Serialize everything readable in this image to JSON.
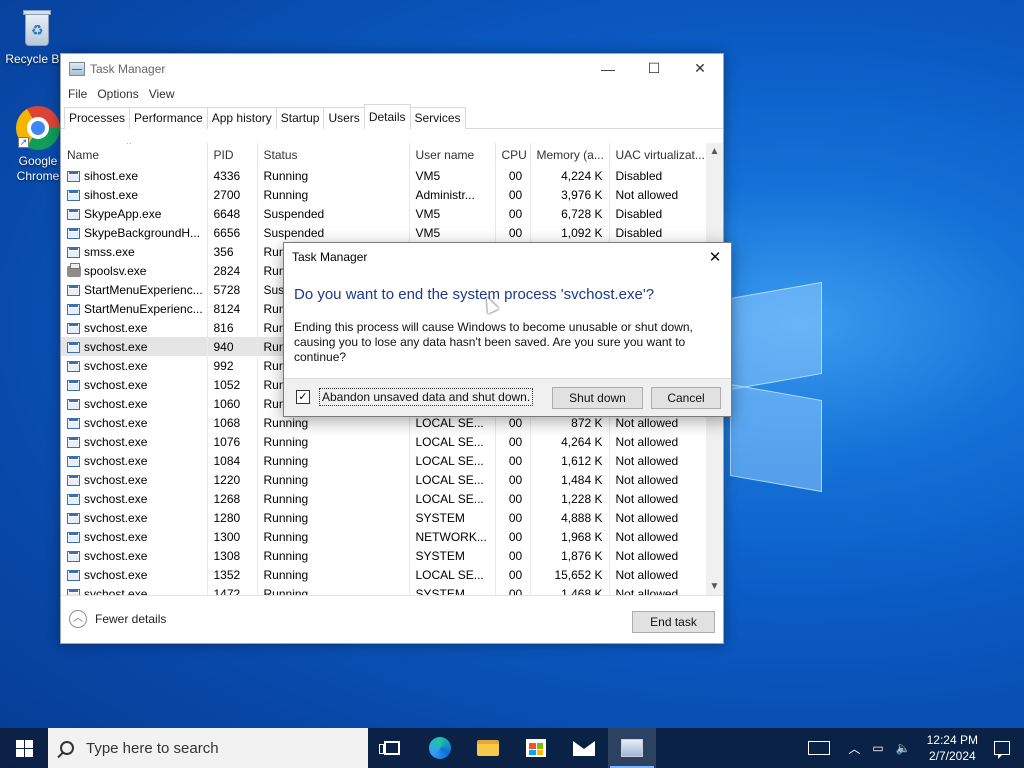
{
  "desktop": {
    "icons": [
      {
        "label": "Recycle Bin"
      },
      {
        "label": "Google Chrome"
      }
    ]
  },
  "task_manager": {
    "title": "Task Manager",
    "menu": [
      "File",
      "Options",
      "View"
    ],
    "tabs": [
      "Processes",
      "Performance",
      "App history",
      "Startup",
      "Users",
      "Details",
      "Services"
    ],
    "active_tab": "Details",
    "columns": [
      "Name",
      "PID",
      "Status",
      "User name",
      "CPU",
      "Memory (a...",
      "UAC virtualizat..."
    ],
    "rows": [
      {
        "name": "sihost.exe",
        "pid": "4336",
        "status": "Running",
        "user": "VM5",
        "cpu": "00",
        "mem": "4,224 K",
        "uac": "Disabled"
      },
      {
        "name": "sihost.exe",
        "pid": "2700",
        "status": "Running",
        "user": "Administr...",
        "cpu": "00",
        "mem": "3,976 K",
        "uac": "Not allowed"
      },
      {
        "name": "SkypeApp.exe",
        "pid": "6648",
        "status": "Suspended",
        "user": "VM5",
        "cpu": "00",
        "mem": "6,728 K",
        "uac": "Disabled"
      },
      {
        "name": "SkypeBackgroundH...",
        "pid": "6656",
        "status": "Suspended",
        "user": "VM5",
        "cpu": "00",
        "mem": "1,092 K",
        "uac": "Disabled"
      },
      {
        "name": "smss.exe",
        "pid": "356",
        "status": "Run",
        "user": "",
        "cpu": "",
        "mem": "",
        "uac": ""
      },
      {
        "name": "spoolsv.exe",
        "pid": "2824",
        "status": "Run",
        "user": "",
        "cpu": "",
        "mem": "",
        "uac": "",
        "icon": "printer"
      },
      {
        "name": "StartMenuExperienc...",
        "pid": "5728",
        "status": "Susp",
        "user": "",
        "cpu": "",
        "mem": "",
        "uac": ""
      },
      {
        "name": "StartMenuExperienc...",
        "pid": "8124",
        "status": "Run",
        "user": "",
        "cpu": "",
        "mem": "",
        "uac": ""
      },
      {
        "name": "svchost.exe",
        "pid": "816",
        "status": "Run",
        "user": "",
        "cpu": "",
        "mem": "",
        "uac": ""
      },
      {
        "name": "svchost.exe",
        "pid": "940",
        "status": "Run",
        "user": "",
        "cpu": "",
        "mem": "",
        "uac": "",
        "selected": true
      },
      {
        "name": "svchost.exe",
        "pid": "992",
        "status": "Run",
        "user": "",
        "cpu": "",
        "mem": "",
        "uac": ""
      },
      {
        "name": "svchost.exe",
        "pid": "1052",
        "status": "Run",
        "user": "",
        "cpu": "",
        "mem": "",
        "uac": ""
      },
      {
        "name": "svchost.exe",
        "pid": "1060",
        "status": "Run",
        "user": "",
        "cpu": "",
        "mem": "",
        "uac": ""
      },
      {
        "name": "svchost.exe",
        "pid": "1068",
        "status": "Running",
        "user": "LOCAL SE...",
        "cpu": "00",
        "mem": "872 K",
        "uac": "Not allowed"
      },
      {
        "name": "svchost.exe",
        "pid": "1076",
        "status": "Running",
        "user": "LOCAL SE...",
        "cpu": "00",
        "mem": "4,264 K",
        "uac": "Not allowed"
      },
      {
        "name": "svchost.exe",
        "pid": "1084",
        "status": "Running",
        "user": "LOCAL SE...",
        "cpu": "00",
        "mem": "1,612 K",
        "uac": "Not allowed"
      },
      {
        "name": "svchost.exe",
        "pid": "1220",
        "status": "Running",
        "user": "LOCAL SE...",
        "cpu": "00",
        "mem": "1,484 K",
        "uac": "Not allowed"
      },
      {
        "name": "svchost.exe",
        "pid": "1268",
        "status": "Running",
        "user": "LOCAL SE...",
        "cpu": "00",
        "mem": "1,228 K",
        "uac": "Not allowed"
      },
      {
        "name": "svchost.exe",
        "pid": "1280",
        "status": "Running",
        "user": "SYSTEM",
        "cpu": "00",
        "mem": "4,888 K",
        "uac": "Not allowed"
      },
      {
        "name": "svchost.exe",
        "pid": "1300",
        "status": "Running",
        "user": "NETWORK...",
        "cpu": "00",
        "mem": "1,968 K",
        "uac": "Not allowed"
      },
      {
        "name": "svchost.exe",
        "pid": "1308",
        "status": "Running",
        "user": "SYSTEM",
        "cpu": "00",
        "mem": "1,876 K",
        "uac": "Not allowed"
      },
      {
        "name": "svchost.exe",
        "pid": "1352",
        "status": "Running",
        "user": "LOCAL SE...",
        "cpu": "00",
        "mem": "15,652 K",
        "uac": "Not allowed"
      },
      {
        "name": "svchost.exe",
        "pid": "1472",
        "status": "Running",
        "user": "SYSTEM",
        "cpu": "00",
        "mem": "1,468 K",
        "uac": "Not allowed"
      }
    ],
    "fewer_details": "Fewer details",
    "end_task": "End task"
  },
  "dialog": {
    "title": "Task Manager",
    "heading": "Do you want to end the system process 'svchost.exe'?",
    "body": "Ending this process will cause Windows to become unusable or shut down, causing you to lose any data hasn't been saved. Are you sure you want to continue?",
    "checkbox_label": "Abandon unsaved data and shut down.",
    "checkbox_checked": true,
    "shut_down": "Shut down",
    "cancel": "Cancel"
  },
  "taskbar": {
    "search_placeholder": "Type here to search",
    "time": "12:24 PM",
    "date": "2/7/2024"
  }
}
